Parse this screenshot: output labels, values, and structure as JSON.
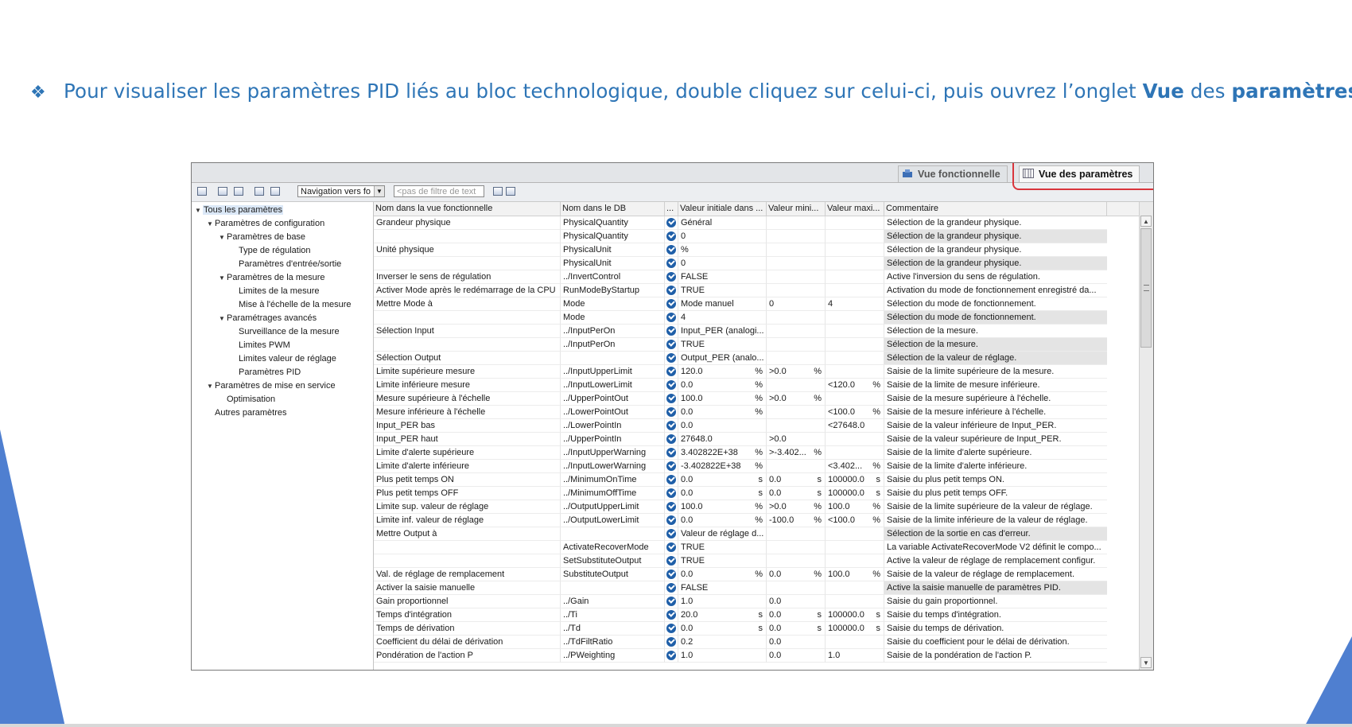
{
  "slide": {
    "bullet": "❖",
    "text_before": "Pour visualiser les paramètres PID liés au bloc technologique, double cliquez sur celui-ci, puis ouvrez l’onglet ",
    "bold1": "Vue",
    "text_mid": " des ",
    "bold2": "paramètres",
    "text_after": "."
  },
  "tabs": {
    "functional": "Vue fonctionnelle",
    "parameters": "Vue des paramètres"
  },
  "toolbar": {
    "navigation_value": "Navigation vers fo",
    "filter_placeholder": "<pas de filtre de text"
  },
  "tree": [
    {
      "label": "Tous les paramètres",
      "level": 0,
      "expanded": true,
      "selected": true
    },
    {
      "label": "Paramètres de configuration",
      "level": 1,
      "expanded": true
    },
    {
      "label": "Paramètres de base",
      "level": 2,
      "expanded": true
    },
    {
      "label": "Type de régulation",
      "level": 3
    },
    {
      "label": "Paramètres d'entrée/sortie",
      "level": 3
    },
    {
      "label": "Paramètres de la mesure",
      "level": 2,
      "expanded": true
    },
    {
      "label": "Limites de la mesure",
      "level": 3
    },
    {
      "label": "Mise à l'échelle de la mesure",
      "level": 3
    },
    {
      "label": "Paramétrages avancés",
      "level": 2,
      "expanded": true
    },
    {
      "label": "Surveillance de la mesure",
      "level": 3
    },
    {
      "label": "Limites PWM",
      "level": 3
    },
    {
      "label": "Limites valeur de réglage",
      "level": 3
    },
    {
      "label": "Paramètres PID",
      "level": 3
    },
    {
      "label": "Paramètres de mise en service",
      "level": 1,
      "expanded": true
    },
    {
      "label": "Optimisation",
      "level": 2
    },
    {
      "label": "Autres paramètres",
      "level": 1
    }
  ],
  "columns": [
    "Nom dans la vue fonctionnelle",
    "Nom dans le DB",
    "...",
    "Valeur initiale dans ...",
    "Valeur mini...",
    "Valeur maxi...",
    "Commentaire"
  ],
  "rows": [
    {
      "desc": "Grandeur physique",
      "db": "PhysicalQuantity",
      "val": "Général",
      "vu": "",
      "min": "",
      "mu": "",
      "max": "",
      "xu": "",
      "com": "Sélection de la grandeur physique."
    },
    {
      "desc": "",
      "db": "PhysicalQuantity",
      "val": "0",
      "vu": "",
      "min": "",
      "mu": "",
      "max": "",
      "xu": "",
      "com": "Sélection de la grandeur physique.",
      "shaded": true
    },
    {
      "desc": "Unité physique",
      "db": "PhysicalUnit",
      "val": "%",
      "vu": "",
      "min": "",
      "mu": "",
      "max": "",
      "xu": "",
      "com": "Sélection de la grandeur physique."
    },
    {
      "desc": "",
      "db": "PhysicalUnit",
      "val": "0",
      "vu": "",
      "min": "",
      "mu": "",
      "max": "",
      "xu": "",
      "com": "Sélection de la grandeur physique.",
      "shaded": true
    },
    {
      "desc": "Inverser le sens de régulation",
      "db": "../InvertControl",
      "val": "FALSE",
      "vu": "",
      "min": "",
      "mu": "",
      "max": "",
      "xu": "",
      "com": "Active l'inversion du sens de régulation."
    },
    {
      "desc": "Activer Mode après le redémarrage de la CPU",
      "db": "RunModeByStartup",
      "val": "TRUE",
      "vu": "",
      "min": "",
      "mu": "",
      "max": "",
      "xu": "",
      "com": "Activation du mode de fonctionnement enregistré da..."
    },
    {
      "desc": "Mettre Mode à",
      "db": "Mode",
      "val": "Mode manuel",
      "vu": "",
      "min": "0",
      "mu": "",
      "max": "4",
      "xu": "",
      "com": "Sélection du mode de fonctionnement."
    },
    {
      "desc": "",
      "db": "Mode",
      "val": "4",
      "vu": "",
      "min": "",
      "mu": "",
      "max": "",
      "xu": "",
      "com": "Sélection du mode de fonctionnement.",
      "shaded": true
    },
    {
      "desc": "Sélection Input",
      "db": "../InputPerOn",
      "val": "Input_PER (analogi...",
      "vu": "",
      "min": "",
      "mu": "",
      "max": "",
      "xu": "",
      "com": "Sélection de la mesure."
    },
    {
      "desc": "",
      "db": "../InputPerOn",
      "val": "TRUE",
      "vu": "",
      "min": "",
      "mu": "",
      "max": "",
      "xu": "",
      "com": "Sélection de la mesure.",
      "shaded": true
    },
    {
      "desc": "Sélection Output",
      "db": "",
      "val": "Output_PER (analo...",
      "vu": "",
      "min": "",
      "mu": "",
      "max": "",
      "xu": "",
      "com": "Sélection de la valeur de réglage.",
      "shaded": true
    },
    {
      "desc": "Limite supérieure mesure",
      "db": "../InputUpperLimit",
      "val": "120.0",
      "vu": "%",
      "min": ">0.0",
      "mu": "%",
      "max": "",
      "xu": "",
      "com": "Saisie de la limite supérieure de la mesure."
    },
    {
      "desc": "Limite inférieure mesure",
      "db": "../InputLowerLimit",
      "val": "0.0",
      "vu": "%",
      "min": "",
      "mu": "",
      "max": "<120.0",
      "xu": "%",
      "com": "Saisie de la limite de mesure inférieure."
    },
    {
      "desc": "Mesure supérieure à l'échelle",
      "db": "../UpperPointOut",
      "val": "100.0",
      "vu": "%",
      "min": ">0.0",
      "mu": "%",
      "max": "",
      "xu": "",
      "com": "Saisie de la mesure supérieure à l'échelle."
    },
    {
      "desc": "Mesure inférieure à l'échelle",
      "db": "../LowerPointOut",
      "val": "0.0",
      "vu": "%",
      "min": "",
      "mu": "",
      "max": "<100.0",
      "xu": "%",
      "com": "Saisie de la mesure inférieure à l'échelle."
    },
    {
      "desc": "Input_PER bas",
      "db": "../LowerPointIn",
      "val": "0.0",
      "vu": "",
      "min": "",
      "mu": "",
      "max": "<27648.0",
      "xu": "",
      "com": "Saisie de la valeur inférieure de Input_PER."
    },
    {
      "desc": "Input_PER haut",
      "db": "../UpperPointIn",
      "val": "27648.0",
      "vu": "",
      "min": ">0.0",
      "mu": "",
      "max": "",
      "xu": "",
      "com": "Saisie de la valeur supérieure de Input_PER."
    },
    {
      "desc": "Limite d'alerte supérieure",
      "db": "../InputUpperWarning",
      "val": "3.402822E+38",
      "vu": "%",
      "min": ">-3.402...",
      "mu": "%",
      "max": "",
      "xu": "",
      "com": "Saisie de la limite d'alerte supérieure."
    },
    {
      "desc": "Limite d'alerte inférieure",
      "db": "../InputLowerWarning",
      "val": "-3.402822E+38",
      "vu": "%",
      "min": "",
      "mu": "",
      "max": "<3.402...",
      "xu": "%",
      "com": "Saisie de la limite d'alerte inférieure."
    },
    {
      "desc": "Plus petit temps ON",
      "db": "../MinimumOnTime",
      "val": "0.0",
      "vu": "s",
      "min": "0.0",
      "mu": "s",
      "max": "100000.0",
      "xu": "s",
      "com": "Saisie du plus petit temps ON."
    },
    {
      "desc": "Plus petit temps OFF",
      "db": "../MinimumOffTime",
      "val": "0.0",
      "vu": "s",
      "min": "0.0",
      "mu": "s",
      "max": "100000.0",
      "xu": "s",
      "com": "Saisie du plus petit temps OFF."
    },
    {
      "desc": "Limite sup. valeur de réglage",
      "db": "../OutputUpperLimit",
      "val": "100.0",
      "vu": "%",
      "min": ">0.0",
      "mu": "%",
      "max": "100.0",
      "xu": "%",
      "com": "Saisie de la limite supérieure de la valeur de réglage."
    },
    {
      "desc": "Limite inf. valeur de réglage",
      "db": "../OutputLowerLimit",
      "val": "0.0",
      "vu": "%",
      "min": "-100.0",
      "mu": "%",
      "max": "<100.0",
      "xu": "%",
      "com": "Saisie de la limite inférieure de la valeur de réglage."
    },
    {
      "desc": "Mettre Output à",
      "db": "",
      "val": "Valeur de réglage d...",
      "vu": "",
      "min": "",
      "mu": "",
      "max": "",
      "xu": "",
      "com": "Sélection de la sortie en cas d'erreur.",
      "shaded": true
    },
    {
      "desc": "",
      "db": "ActivateRecoverMode",
      "val": "TRUE",
      "vu": "",
      "min": "",
      "mu": "",
      "max": "",
      "xu": "",
      "com": "La variable ActivateRecoverMode V2 définit le compo..."
    },
    {
      "desc": "",
      "db": "SetSubstituteOutput",
      "val": "TRUE",
      "vu": "",
      "min": "",
      "mu": "",
      "max": "",
      "xu": "",
      "com": "Active la valeur de réglage de remplacement configur."
    },
    {
      "desc": "Val. de réglage de remplacement",
      "db": "SubstituteOutput",
      "val": "0.0",
      "vu": "%",
      "min": "0.0",
      "mu": "%",
      "max": "100.0",
      "xu": "%",
      "com": "Saisie de la valeur de réglage de remplacement."
    },
    {
      "desc": "Activer la saisie manuelle",
      "db": "",
      "val": "FALSE",
      "vu": "",
      "min": "",
      "mu": "",
      "max": "",
      "xu": "",
      "com": "Active la saisie manuelle de paramètres PID.",
      "shaded": true
    },
    {
      "desc": "Gain proportionnel",
      "db": "../Gain",
      "val": "1.0",
      "vu": "",
      "min": "0.0",
      "mu": "",
      "max": "",
      "xu": "",
      "com": "Saisie du gain proportionnel."
    },
    {
      "desc": "Temps d'intégration",
      "db": "../Ti",
      "val": "20.0",
      "vu": "s",
      "min": "0.0",
      "mu": "s",
      "max": "100000.0",
      "xu": "s",
      "com": "Saisie du temps d'intégration."
    },
    {
      "desc": "Temps de dérivation",
      "db": "../Td",
      "val": "0.0",
      "vu": "s",
      "min": "0.0",
      "mu": "s",
      "max": "100000.0",
      "xu": "s",
      "com": "Saisie du temps de dérivation."
    },
    {
      "desc": "Coefficient du délai de dérivation",
      "db": "../TdFiltRatio",
      "val": "0.2",
      "vu": "",
      "min": "0.0",
      "mu": "",
      "max": "",
      "xu": "",
      "com": "Saisie du coefficient pour le délai de dérivation."
    },
    {
      "desc": "Pondération de l'action P",
      "db": "../PWeighting",
      "val": "1.0",
      "vu": "",
      "min": "0.0",
      "mu": "",
      "max": "1.0",
      "xu": "",
      "com": "Saisie de la pondération de l'action P."
    }
  ]
}
